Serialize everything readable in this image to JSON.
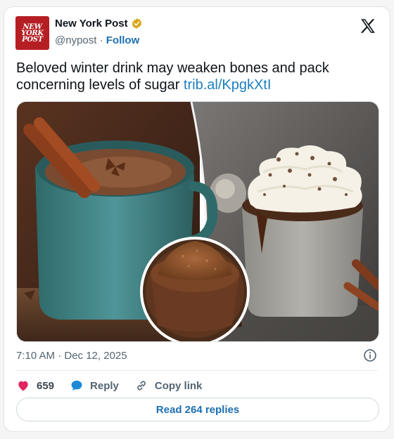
{
  "account": {
    "name": "New York Post",
    "handle": "@nypost",
    "separator": " · ",
    "follow_label": "Follow",
    "avatar_text": [
      "NEW",
      "YORK",
      "POST"
    ],
    "verified_color": "#d4a017"
  },
  "tweet": {
    "text": "Beloved winter drink may weaken bones and pack concerning levels of sugar ",
    "link": "trib.al/KpgkXtI",
    "time": "7:10 AM · Dec 12, 2025"
  },
  "media": {
    "icons": [
      "hot-chocolate-photo"
    ]
  },
  "actions": {
    "like_count": "659",
    "reply_label": "Reply",
    "copy_link_label": "Copy link"
  },
  "read_replies_label": "Read 264 replies",
  "colors": {
    "accent": "#1d6fb0",
    "like": "#e0245e",
    "brand": "#b51f24"
  }
}
